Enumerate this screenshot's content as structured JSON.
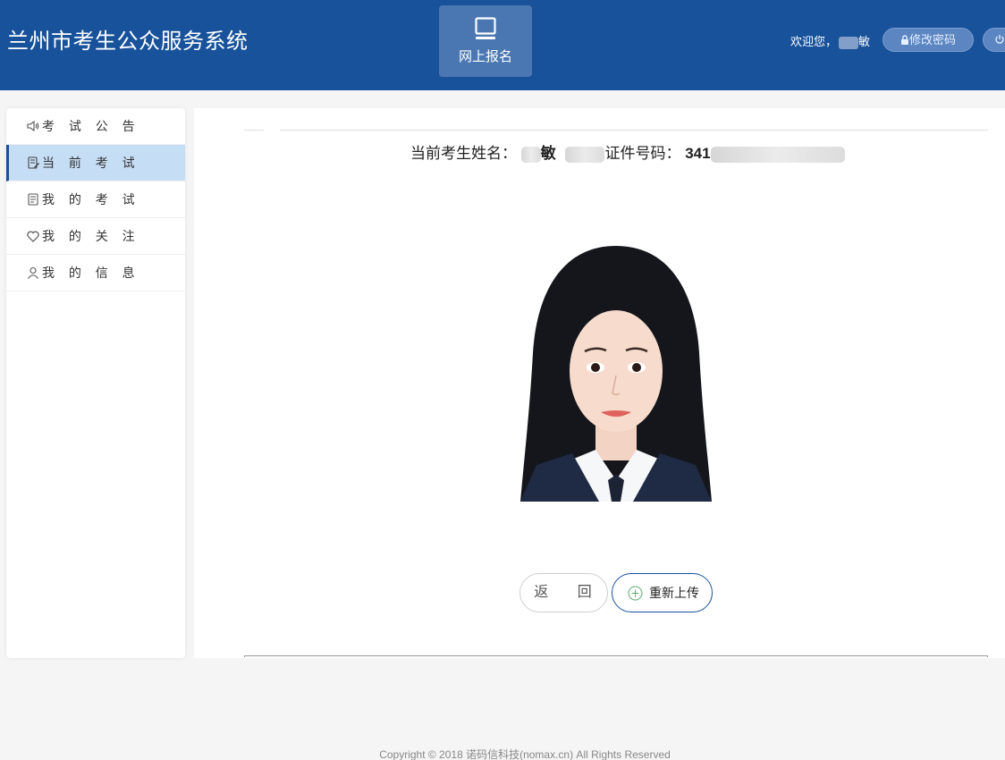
{
  "header": {
    "app_title": "兰州市考生公众服务系统",
    "nav_tile_label": "网上报名",
    "welcome_text": "欢迎您，",
    "welcome_name_visible": "敏",
    "change_password_label": "修改密码",
    "background_color": "#18529b"
  },
  "sidebar": {
    "items": [
      {
        "label": "考 试 公 告",
        "icon": "speaker-icon",
        "active": false
      },
      {
        "label": "当 前 考 试",
        "icon": "document-edit-icon",
        "active": true
      },
      {
        "label": "我 的 考 试",
        "icon": "document-list-icon",
        "active": false
      },
      {
        "label": "我 的 关 注",
        "icon": "heart-icon",
        "active": false
      },
      {
        "label": "我 的 信 息",
        "icon": "user-icon",
        "active": false
      }
    ]
  },
  "main": {
    "name_label": "当前考生姓名：",
    "name_value_visible": "敏",
    "id_label": "证件号码：",
    "id_value_visible": "341",
    "back_button": "返 回",
    "reupload_button": "重新上传"
  },
  "footer": {
    "copyright": "Copyright © 2018 诺码信科技(nomax.cn) All Rights Reserved"
  },
  "colors": {
    "primary": "#18529b",
    "active_nav": "#c6ddf6"
  }
}
